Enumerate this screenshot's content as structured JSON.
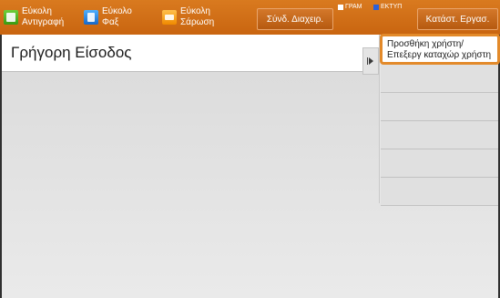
{
  "shortcuts": [
    {
      "line1": "Εύκολη",
      "line2": "Αντιγραφή",
      "icon": "copy-icon"
    },
    {
      "line1": "Εύκολο",
      "line2": "Φαξ",
      "icon": "fax-icon"
    },
    {
      "line1": "Εύκολη",
      "line2": "Σάρωση",
      "icon": "scan-icon"
    }
  ],
  "admin_button": "Σύνδ. Διαχειρ.",
  "indicators": [
    {
      "label": "ΓΡΑΜ",
      "color": "#ffffff"
    },
    {
      "label": "ΕΚΤΥΠ",
      "color": "#2b60d8"
    }
  ],
  "job_status_button": "Κατάστ. Εργασ.",
  "page_title": "Γρήγορη Είσοδος",
  "menu": {
    "items": [
      {
        "label": "Προσθήκη χρήστη/ Επεξεργ καταχώρ χρήστη"
      },
      {
        "label": ""
      },
      {
        "label": ""
      },
      {
        "label": ""
      },
      {
        "label": ""
      },
      {
        "label": ""
      }
    ]
  },
  "colors": {
    "accent": "#d4782a",
    "highlight": "#e38a2a"
  }
}
